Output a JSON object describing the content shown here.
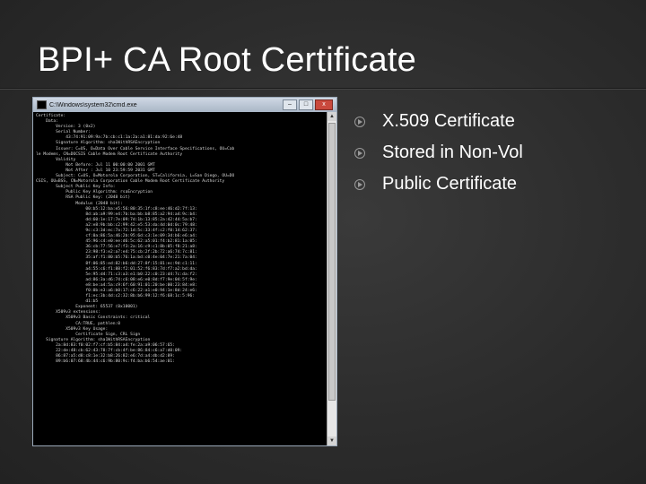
{
  "slide": {
    "title": "BPI+ CA Root Certificate",
    "bullets": [
      "X.509 Certificate",
      "Stored in Non-Vol",
      "Public Certificate"
    ]
  },
  "cmd": {
    "window_title": "C:\\Windows\\system32\\cmd.exe",
    "minimize_label": "–",
    "maximize_label": "□",
    "close_label": "x",
    "scroll_up": "▲",
    "scroll_down": "▼",
    "lines": [
      "Certificate:",
      "    Data:",
      "        Version: 3 (0x2)",
      "        Serial Number:",
      "            43:74:91:09:9a:7b:cb:c1:1a:2a:a1:81:da:92:6e:48",
      "        Signature Algorithm: sha1WithRSAEncryption",
      "        Issuer: C=US, O=Data Over Cable Service Interface Specifications, OU=Cab",
      "le Modems, CN=DOCSIS Cable Modem Root Certificate Authority",
      "        Validity",
      "            Not Before: Jul 11 00:00:00 2001 GMT",
      "            Not After : Jul 10 23:59:59 2031 GMT",
      "        Subject: C=US, O=Motorola Corporation, ST=California, L=San Diego, OU=DO",
      "CSIS, OU=BSS, CN=Motorola Corporation Cable Modem Root Certificate Authority",
      "        Subject Public Key Info:",
      "            Public Key Algorithm: rsaEncryption",
      "            RSA Public Key: (2048 bit)",
      "                Modulus (2048 bit):",
      "                    00:b5:12:ba:e5:56:80:35:1f:c8:ee:46:d2:7f:13:",
      "                    8d:ab:a9:99:e4:7b:ba:bb:b8:85:a2:94:a4:9c:b4:",
      "                    dd:60:1e:17:7e:09:7d:1b:13:85:2a:42:44:5a:b7:",
      "                    a2:e8:9b:bb:c2:99:42:e5:53:da:4d:0d:0c:79:48:",
      "                    9c:c3:3d:ec:7a:72:1d:5c:33:4f:c2:f0:14:62:37:",
      "                    cf:0a:86:5a:46:2b:95:6d:c3:1e:09:3d:b6:e6:a4:",
      "                    45:96:c4:e0:ee:d6:5c:62:a5:01:f4:b2:81:1a:05:",
      "                    36:cb:77:56:e7:f3:2a:16:c9:c1:8b:05:f8:21:a8:",
      "                    23:98:f3:e2:a7:e4:75:cb:2f:2b:72:a6:74:7c:81:",
      "                    35:af:f1:80:b5:76:1a:bd:c0:4e:04:7e:21:7a:04:",
      "                    8f:06:85:ed:82:b6:dd:27:8f:15:81:ec:9d:c1:11:",
      "                    a4:55:c6:f1:88:f2:01:52:f6:83:7d:f7:a2:bd:da:",
      "                    5e:95:d4:71:c3:a3:e1:b0:22:c0:23:d4:7c:da:f2:",
      "                    ad:86:3a:d6:74:c6:08:e6:e0:8d:f7:9e:04:5f:9e:",
      "                    e8:be:a4:5a:c9:6f:60:91:01:20:be:00:23:84:e8:",
      "                    f0:0b:e3:a6:b0:17:c6:22:a1:e0:94:1e:8d:24:e6:",
      "                    f1:ec:3b:4d:c2:32:8b:b6:99:12:f6:68:1c:5:96:",
      "                    d1:b5",
      "                Exponent: 65537 (0x10001)",
      "        X509v3 extensions:",
      "            X509v3 Basic Constraints: critical",
      "                CA:TRUE, pathlen:0",
      "            X509v3 Key Usage:",
      "                Certificate Sign, CRL Sign",
      "    Signature Algorithm: sha1WithRSAEncryption",
      "        2a:8d:83:f0:02:f7:cf:b5:84:a4:fe:2a:a9:06:57:65:",
      "        22:de:48:cb:62:43:78:7f:cb:4f:be:86:84:c6:a7:d0:09:",
      "        86:87:a5:d8:c8:1e:32:b8:26:82:e6:7d:a4:db:d2:89:",
      "        89:b6:07:68:4b:44:c6:9b:80:9c:f4:ba:b6:54:ae:01:"
    ]
  }
}
